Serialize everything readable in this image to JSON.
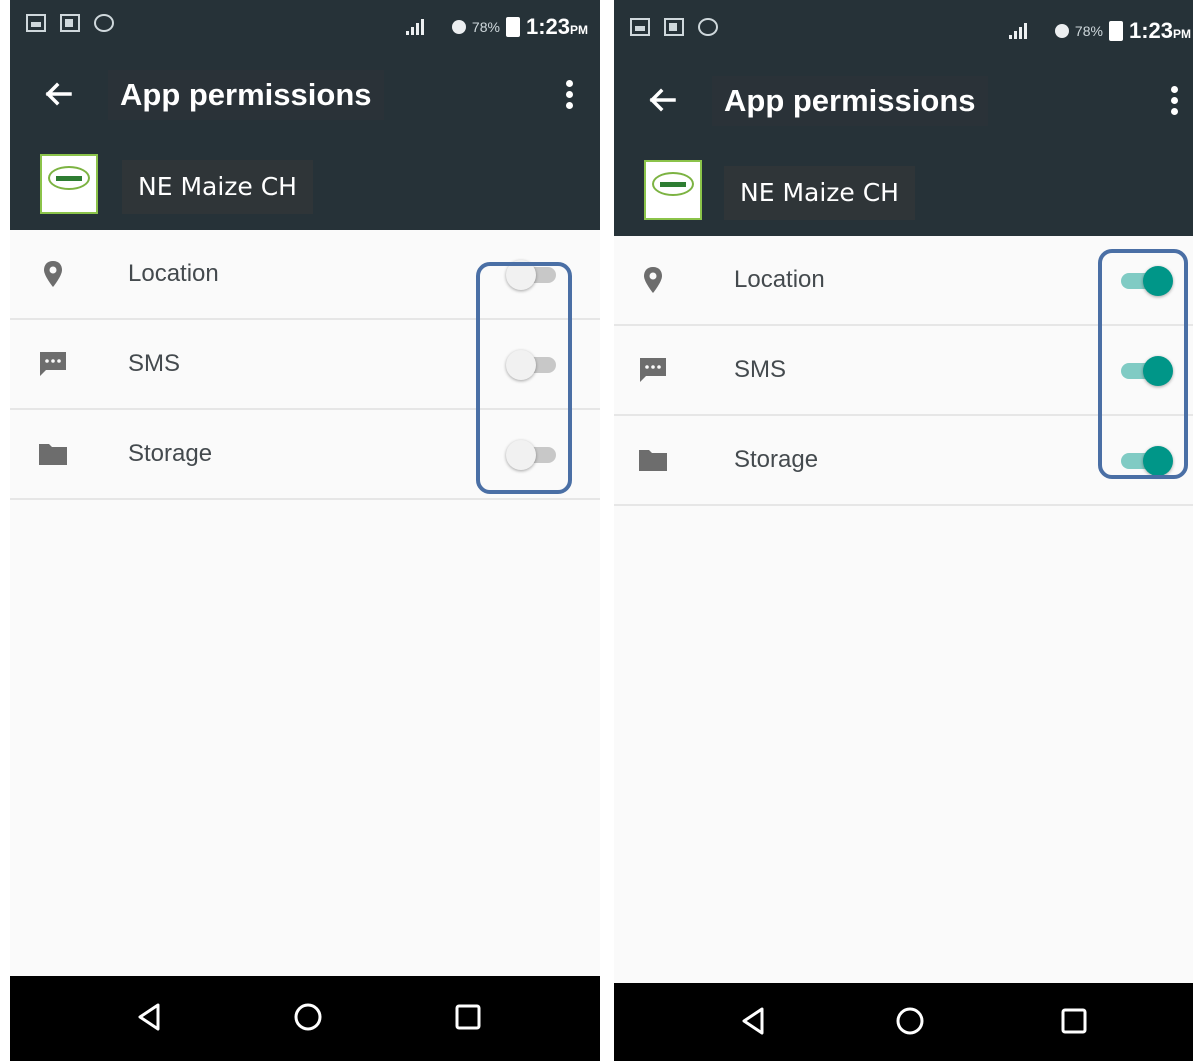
{
  "screens": [
    {
      "title": "App permissions",
      "app_name": "NE Maize CH",
      "status": {
        "battery_pct": "78%",
        "time": "1:23",
        "ampm": "PM"
      },
      "permissions": [
        {
          "label": "Location",
          "icon": "location-pin-icon",
          "enabled": false
        },
        {
          "label": "SMS",
          "icon": "sms-icon",
          "enabled": false
        },
        {
          "label": "Storage",
          "icon": "folder-icon",
          "enabled": false
        }
      ]
    },
    {
      "title": "App permissions",
      "app_name": "NE Maize CH",
      "status": {
        "battery_pct": "78%",
        "time": "1:23",
        "ampm": "PM"
      },
      "permissions": [
        {
          "label": "Location",
          "icon": "location-pin-icon",
          "enabled": true
        },
        {
          "label": "SMS",
          "icon": "sms-icon",
          "enabled": true
        },
        {
          "label": "Storage",
          "icon": "folder-icon",
          "enabled": true
        }
      ]
    }
  ],
  "colors": {
    "appbar": "#263238",
    "toggle_on": "#009688",
    "toggle_off": "#c8c8c8",
    "highlight_border": "#4a6fa5",
    "navbar": "#000000"
  }
}
